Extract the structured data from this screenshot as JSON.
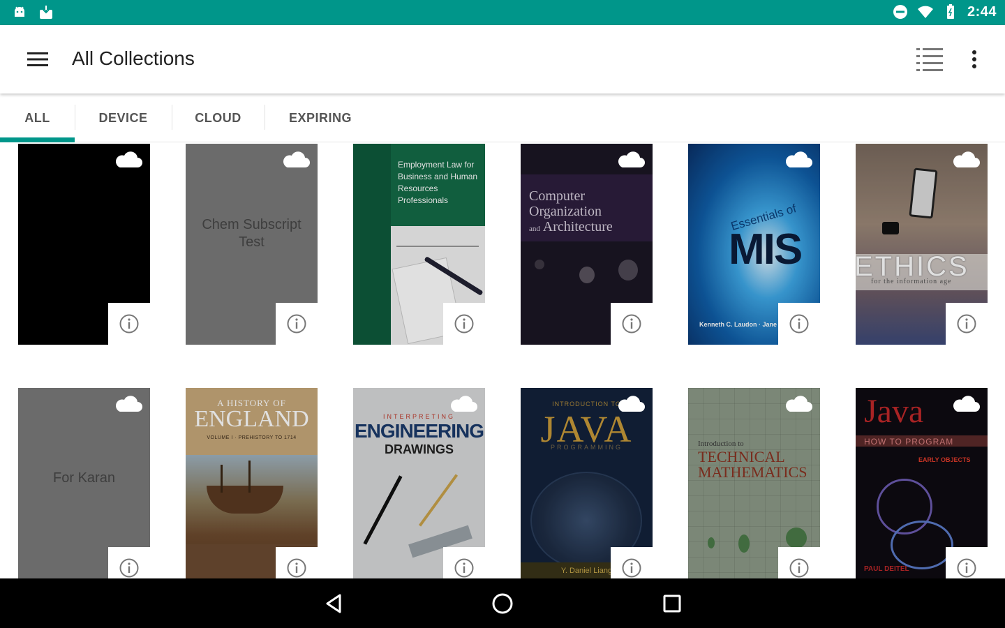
{
  "status_bar": {
    "time": "2:44",
    "icons": [
      "android-icon",
      "download-icon",
      "do-not-disturb-icon",
      "wifi-icon",
      "battery-icon"
    ],
    "color": "#00968a"
  },
  "app_bar": {
    "title": "All Collections",
    "icons": [
      "menu-icon",
      "list-view-icon",
      "more-vert-icon"
    ]
  },
  "tabs": [
    {
      "label": "ALL",
      "active": true
    },
    {
      "label": "DEVICE",
      "active": false
    },
    {
      "label": "CLOUD",
      "active": false
    },
    {
      "label": "EXPIRING",
      "active": false
    }
  ],
  "accent_color": "#00968a",
  "books": [
    {
      "cover_title": "",
      "placeholder": true,
      "cloud": true
    },
    {
      "cover_title": "Chem Subscript Test",
      "placeholder": true,
      "cloud": true
    },
    {
      "cover_title": "Employment Law for Business and Human Resources Professionals",
      "placeholder": false,
      "cloud": false
    },
    {
      "cover_title": "Computer Organization and Architecture",
      "placeholder": false,
      "cloud": true
    },
    {
      "cover_title": "Essentials of MIS",
      "placeholder": false,
      "cloud": true
    },
    {
      "cover_title": "ETHICS for the information age",
      "placeholder": false,
      "cloud": true
    },
    {
      "cover_title": "For Karan",
      "placeholder": true,
      "cloud": true
    },
    {
      "cover_title": "A HISTORY OF ENGLAND",
      "placeholder": false,
      "cloud": false
    },
    {
      "cover_title": "INTERPRETING ENGINEERING DRAWINGS",
      "placeholder": false,
      "cloud": true
    },
    {
      "cover_title": "JAVA PROGRAMMING",
      "placeholder": false,
      "cloud": true
    },
    {
      "cover_title": "Introduction to TECHNICAL MATHEMATICS",
      "placeholder": false,
      "cloud": true
    },
    {
      "cover_title": "Java HOW TO PROGRAM",
      "placeholder": false,
      "cloud": true
    }
  ],
  "covers": {
    "employment_law": {
      "lines": [
        "Employment Law for",
        "Business and Human",
        "Resources Professionals"
      ]
    },
    "comp_org": {
      "lines": [
        "Computer",
        "Organization",
        "Architecture"
      ],
      "and": "and"
    },
    "mis": {
      "prefix": "Essentials of",
      "main": "MIS",
      "authors": "Kenneth C. Laudon · Jane P."
    },
    "ethics": {
      "main": "ETHICS",
      "sub": "for the information age"
    },
    "england": {
      "prefix": "A HISTORY OF",
      "main": "ENGLAND",
      "sub": "VOLUME I · PREHISTORY TO 1714"
    },
    "eng_drawings": {
      "prefix": "INTERPRETING",
      "main": "ENGINEERING",
      "sub": "DRAWINGS"
    },
    "java_prog": {
      "prefix": "INTRODUCTION TO",
      "main": "JAVA",
      "sub": "PROGRAMMING",
      "author": "Y. Daniel Liang"
    },
    "tech_math": {
      "prefix": "Introduction to",
      "line1": "TECHNICAL",
      "line2": "MATHEMATICS"
    },
    "java_htp": {
      "main": "Java",
      "sub": "HOW TO PROGRAM",
      "edition": "EARLY OBJECTS",
      "author": "PAUL DEITEL"
    }
  },
  "nav_bar": {
    "icons": [
      "back-icon",
      "home-icon",
      "recents-icon"
    ]
  }
}
